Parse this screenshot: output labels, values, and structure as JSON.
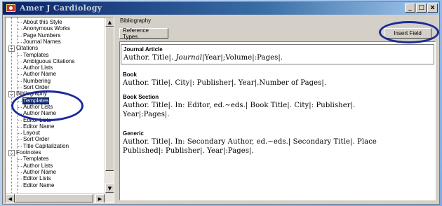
{
  "window": {
    "title": "Amer J Cardiology",
    "controls": {
      "minimize": "_",
      "maximize": "□",
      "close": "x"
    }
  },
  "tree": {
    "nodes": [
      {
        "label": "About this Style",
        "level": 1
      },
      {
        "label": "Anonymous Works",
        "level": 1
      },
      {
        "label": "Page Numbers",
        "level": 1
      },
      {
        "label": "Journal Names",
        "level": 1
      },
      {
        "label": "Citations",
        "level": 0,
        "expander": "−"
      },
      {
        "label": "Templates",
        "level": 1
      },
      {
        "label": "Ambiguous Citations",
        "level": 1
      },
      {
        "label": "Author Lists",
        "level": 1
      },
      {
        "label": "Author Name",
        "level": 1
      },
      {
        "label": "Numbering",
        "level": 1
      },
      {
        "label": "Sort Order",
        "level": 1
      },
      {
        "label": "Bibliography",
        "level": 0,
        "expander": "−"
      },
      {
        "label": "Templates",
        "level": 1,
        "selected": true
      },
      {
        "label": "Author Lists",
        "level": 1
      },
      {
        "label": "Author Name",
        "level": 1
      },
      {
        "label": "Editor Lists",
        "level": 1
      },
      {
        "label": "Editor Name",
        "level": 1
      },
      {
        "label": "Layout",
        "level": 1
      },
      {
        "label": "Sort Order",
        "level": 1
      },
      {
        "label": "Title Capitalization",
        "level": 1
      },
      {
        "label": "Footnotes",
        "level": 0,
        "expander": "−"
      },
      {
        "label": "Templates",
        "level": 1
      },
      {
        "label": "Author Lists",
        "level": 1
      },
      {
        "label": "Author Name",
        "level": 1
      },
      {
        "label": "Editor Lists",
        "level": 1
      },
      {
        "label": "Editor Name",
        "level": 1
      }
    ]
  },
  "content": {
    "section_title": "Bibliography",
    "reference_types_button": "Reference Types",
    "insert_field_button": "Insert Field",
    "templates": [
      {
        "name": "Journal Article",
        "fields_prefix": "Author. Title|.",
        "fields_italic": "Journal",
        "fields_suffix": "|Year|;Volume|:Pages|.",
        "selected": true
      },
      {
        "name": "Book",
        "fields": "Author. Title|. City|: Publisher|. Year|.Number of Pages|."
      },
      {
        "name": "Book Section",
        "fields": "Author. Title|. In: Editor, ed.~eds.| Book Title|. City|: Publisher|.\nYear|:Pages|."
      },
      {
        "name": "Generic",
        "fields": "Author. Title|. In: Secondary Author, ed.~eds.| Secondary Title|. Place\nPublished|: Publisher|. Year|:Pages|."
      }
    ]
  },
  "colors": {
    "title_bar_start": "#0a246a",
    "title_bar_end": "#a6caf0",
    "selection": "#0a246a",
    "annotation_ellipse": "#1a2a9a",
    "window_face": "#d4d0c8"
  }
}
